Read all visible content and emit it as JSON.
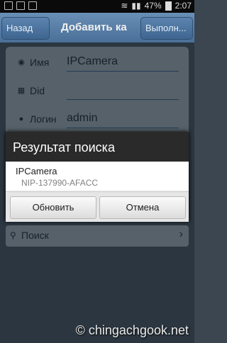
{
  "status_bar": {
    "battery": "47%",
    "time": "2:07"
  },
  "titlebar": {
    "back_label": "Назад",
    "title": "Добавить ка",
    "apply_label": "Выполн..."
  },
  "form": {
    "name_label": "Имя",
    "name_value": "IPCamera",
    "did_label": "Did",
    "did_value": "",
    "login_label": "Логин",
    "login_value": "admin"
  },
  "dialog": {
    "title": "Результат поиска",
    "result_name": "IPCamera",
    "result_id": "NIP-137990-AFACC",
    "refresh_label": "Обновить",
    "cancel_label": "Отмена"
  },
  "search": {
    "label": "Поиск"
  },
  "watermark": "© chingachgook.net",
  "colors": {
    "titlebar": "#5a82ad",
    "dialog_title": "#2a2a2a",
    "background": "#3b4650"
  }
}
